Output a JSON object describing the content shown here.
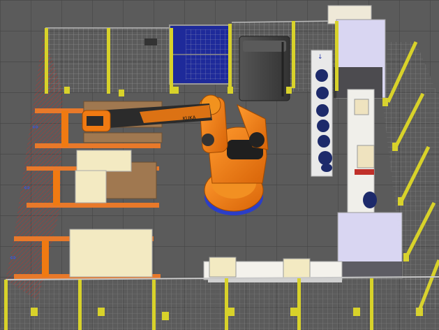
{
  "scene": {
    "robot_brand_text": "KUKA",
    "colors": {
      "floor": "#5b5b5b",
      "grid_line": "#3f3f3f",
      "fence_post": "#d8d22a",
      "fence_mesh": "#cfcfcf",
      "light_curtain": "#c0302a",
      "robot_orange": "#f07a12",
      "robot_dark": "#2b2b2b",
      "conveyor_blue": "#1e2a9a",
      "pallet_wood": "#a07850",
      "box_cream": "#f3eac2",
      "cabinet_lavender": "#d9d6f2",
      "control_cabinet": "#4a4a4a",
      "part_navy": "#1d2a6b",
      "rail_orange": "#e8792a"
    },
    "icons": {
      "light_curtain_arrow": "double-arrow-icon",
      "part_rack_marker": "down-arrow-icon"
    }
  }
}
